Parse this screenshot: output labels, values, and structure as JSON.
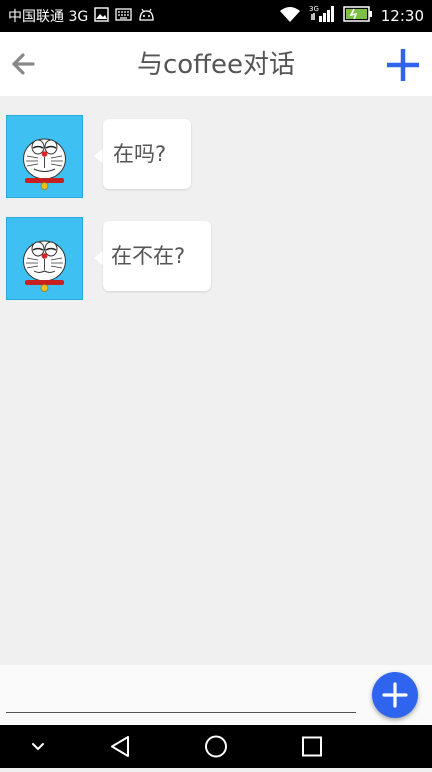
{
  "status_bar": {
    "carrier": "中国联通 3G",
    "network": "3G",
    "time": "12:30",
    "icons": [
      "image-icon",
      "keyboard-icon",
      "android-icon",
      "wifi-icon",
      "signal-icon",
      "battery-icon"
    ]
  },
  "header": {
    "title": "与coffee对话",
    "back_icon": "arrow-left-icon",
    "add_icon": "plus-icon",
    "accent_color": "#2f64ee"
  },
  "messages": [
    {
      "avatar": "doraemon-avatar",
      "text": "在吗?"
    },
    {
      "avatar": "doraemon-avatar",
      "text": "在不在?"
    }
  ],
  "composer": {
    "value": "",
    "send_icon": "plus-icon",
    "fab_color": "#2f64ee"
  },
  "nav_bar": {
    "icons": [
      "chevron-down-icon",
      "back-triangle-icon",
      "home-circle-icon",
      "recents-square-icon"
    ]
  }
}
